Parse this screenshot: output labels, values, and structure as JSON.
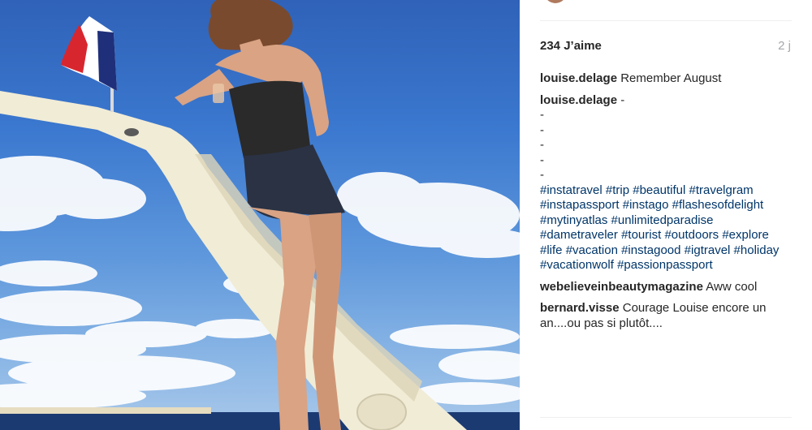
{
  "post": {
    "likes": "234 J’aime",
    "time_ago": "2 j"
  },
  "caption": {
    "user": "louise.delage",
    "text": "Remember August"
  },
  "hashtag_comment": {
    "user": "louise.delage",
    "first_line": "-",
    "dashes": [
      "-",
      "-",
      "-",
      "-",
      "-"
    ],
    "hashtags": [
      "#instatravel",
      "#trip",
      "#beautiful",
      "#travelgram",
      "#instapassport",
      "#instago",
      "#flashesofdelight",
      "#mytinyatlas",
      "#unlimitedparadise",
      "#dametraveler",
      "#tourist",
      "#outdoors",
      "#explore",
      "#life",
      "#vacation",
      "#instagood",
      "#igtravel",
      "#holiday",
      "#vacationwolf",
      "#passionpassport"
    ]
  },
  "comments": [
    {
      "user": "webelieveinbeautymagazine",
      "text": "Aww cool"
    },
    {
      "user": "bernard.visse",
      "text": "Courage Louise encore un an....ou pas si plutôt...."
    }
  ],
  "colors": {
    "hashtag": "#003569",
    "timestamp": "#a5a7aa",
    "flag_blue": "#1f2f7a",
    "flag_red": "#d8262f",
    "boat": "#f1ecd6"
  }
}
